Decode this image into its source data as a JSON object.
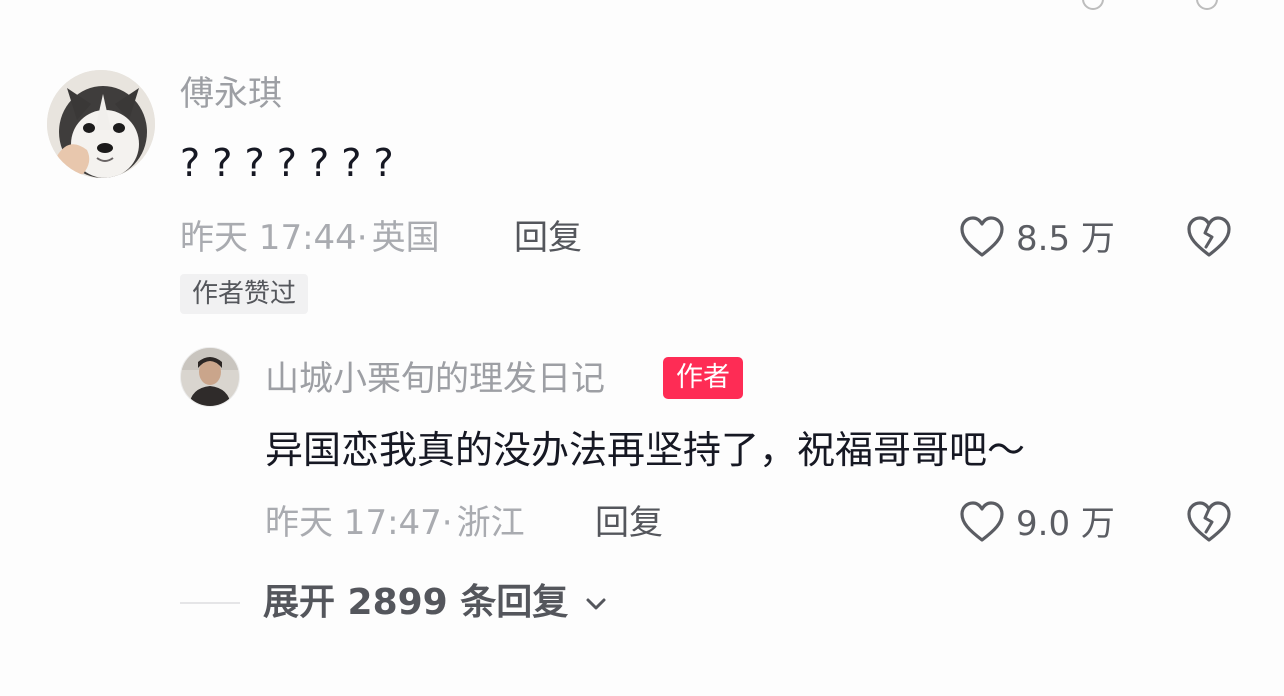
{
  "comment": {
    "username": "傅永琪",
    "text": "? ? ? ? ? ? ?",
    "time": "昨天 17:44",
    "location_sep": "·",
    "location": "英国",
    "reply_label": "回复",
    "like_count": "8.5 万",
    "badge": "作者赞过"
  },
  "reply": {
    "username": "山城小栗旬的理发日记",
    "author_tag": "作者",
    "text": "异国恋我真的没办法再坚持了，祝福哥哥吧～",
    "time": "昨天 17:47",
    "location_sep": "·",
    "location": "浙江",
    "reply_label": "回复",
    "like_count": "9.0 万"
  },
  "expand": {
    "label": "展开 2899 条回复"
  },
  "icons": {
    "like": "heart-outline-icon",
    "dislike": "broken-heart-icon",
    "expand": "chevron-down-icon"
  },
  "colors": {
    "author_tag": "#fe2c55",
    "muted_text": "#a9abb0",
    "primary_text": "#161823"
  }
}
